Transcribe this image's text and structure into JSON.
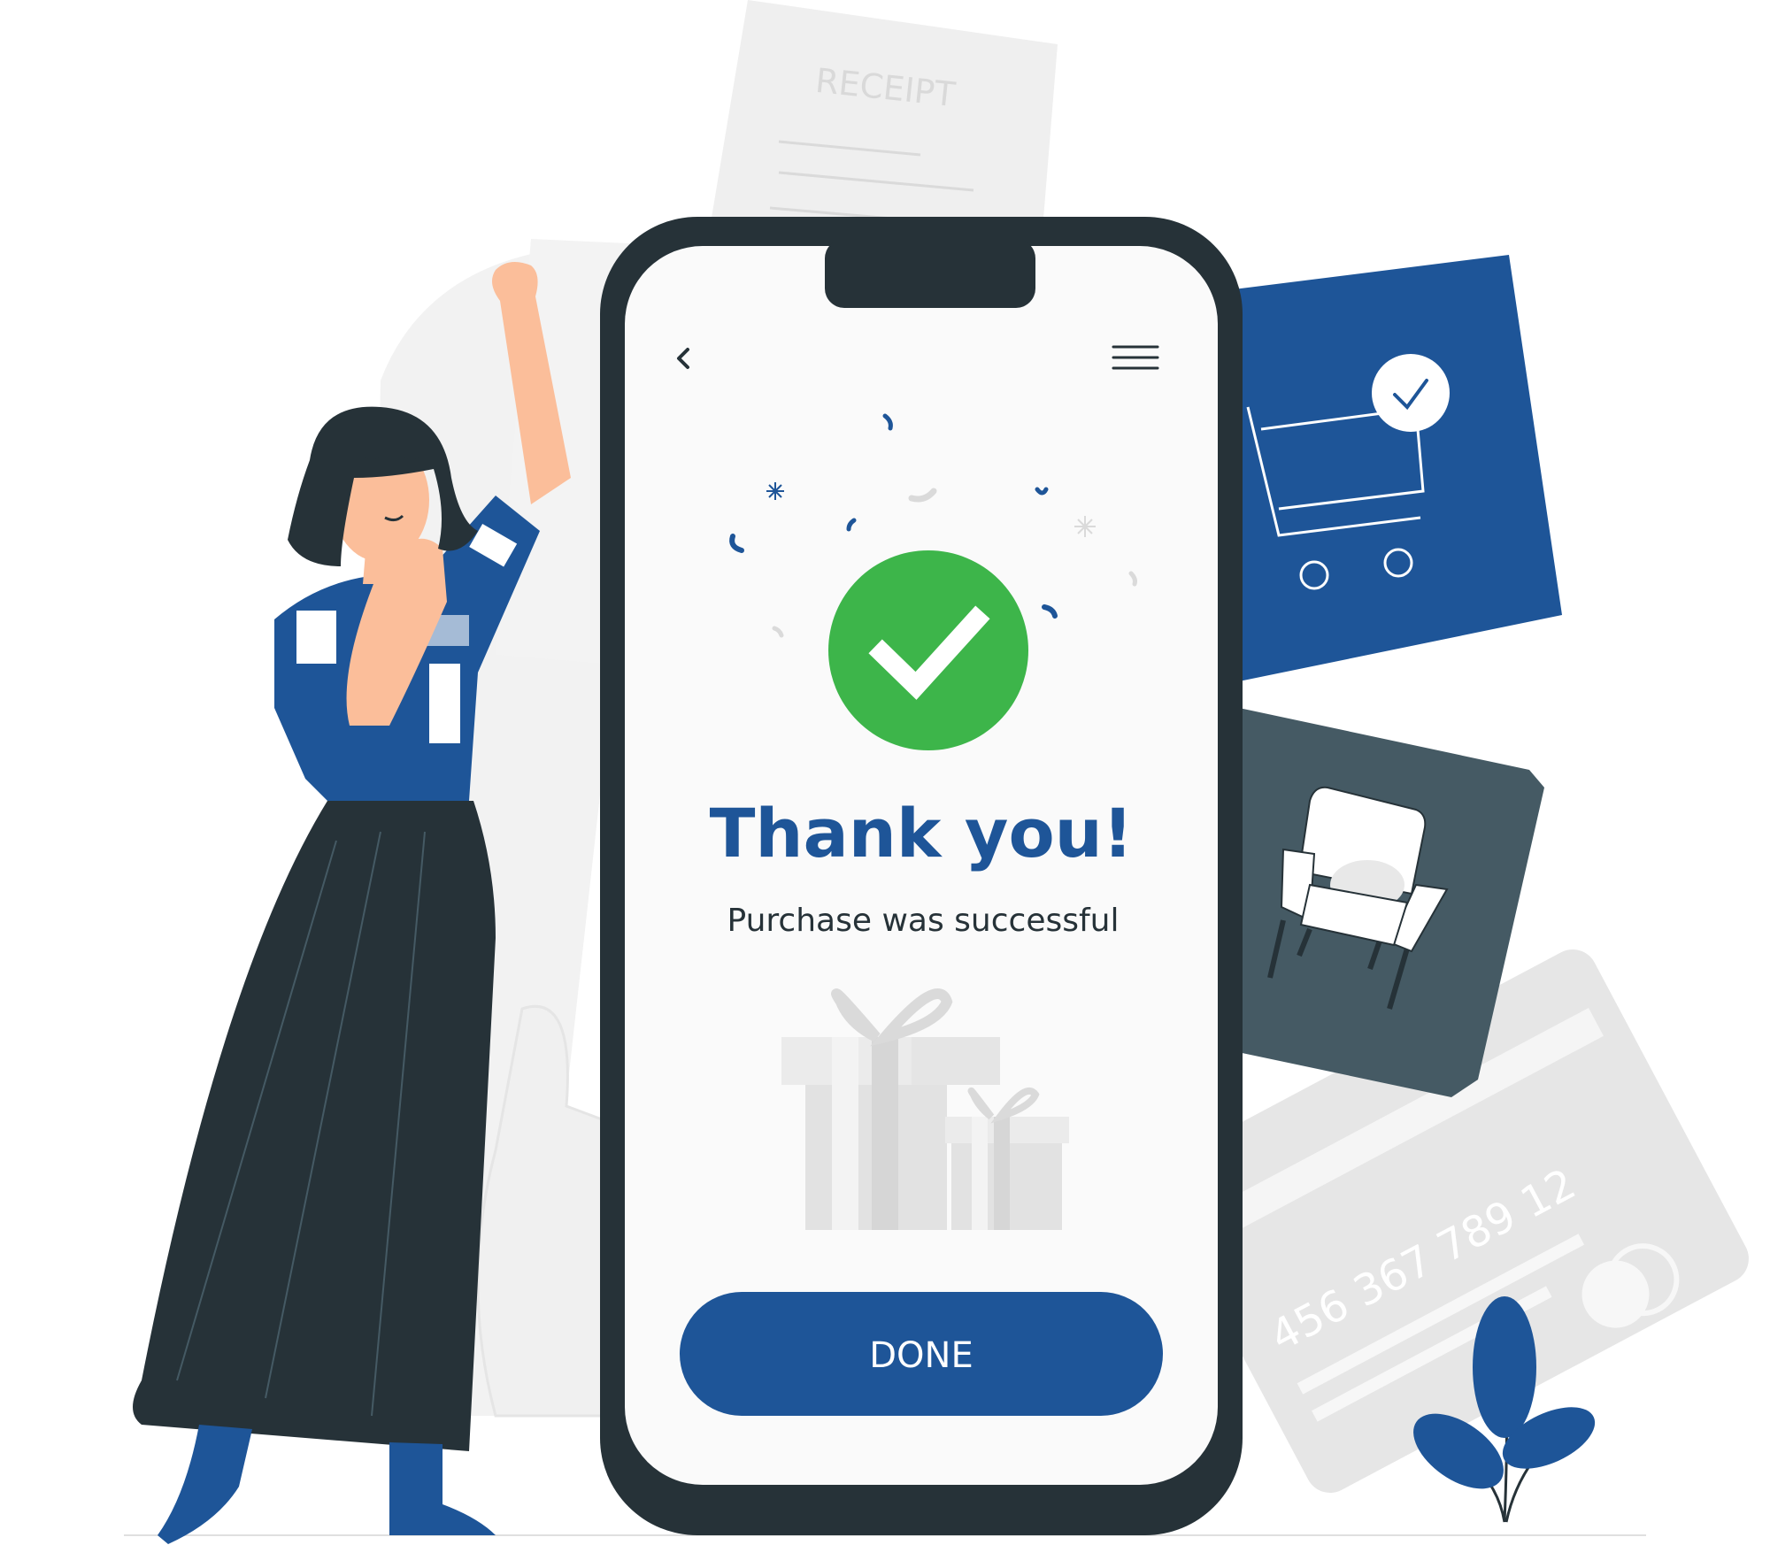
{
  "colors": {
    "brand_blue": "#1E5598",
    "dark": "#263238",
    "gray_card": "#455A64",
    "success_green": "#3DB54A",
    "bg_gray": "#F2F2F2",
    "screen_bg": "#FAFAFA",
    "skin": "#FBBE9A"
  },
  "receipt": {
    "label": "RECEIPT"
  },
  "phone": {
    "back_icon": "chevron-left-icon",
    "menu_icon": "hamburger-menu-icon",
    "success_icon": "check-circle-icon",
    "title": "Thank you!",
    "subtitle": "Purchase was successful",
    "done_label": "DONE"
  },
  "cart_card": {
    "icon": "shopping-cart-icon",
    "badge_icon": "check-badge-icon"
  },
  "chair_card": {
    "icon": "armchair-icon"
  },
  "credit_card": {
    "number": "456 367 789 12"
  },
  "gift_icon": "gift-boxes-icon",
  "plant_icon": "plant-icon"
}
